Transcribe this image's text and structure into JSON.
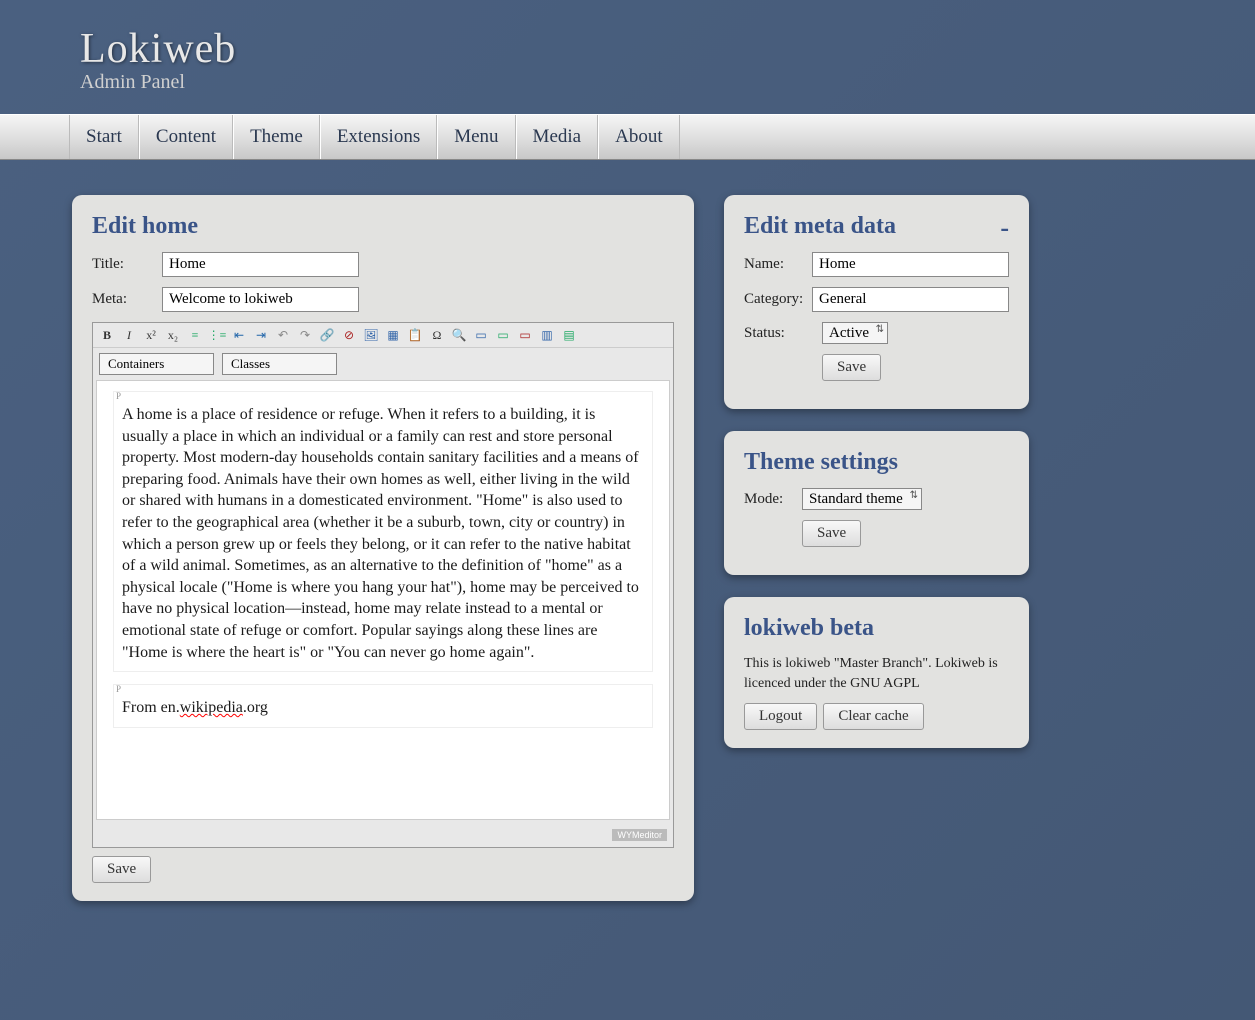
{
  "header": {
    "title": "Lokiweb",
    "subtitle": "Admin Panel"
  },
  "nav": {
    "items": [
      "Start",
      "Content",
      "Theme",
      "Extensions",
      "Menu",
      "Media",
      "About"
    ]
  },
  "editor": {
    "heading": "Edit home",
    "title_label": "Title:",
    "title_value": "Home",
    "meta_label": "Meta:",
    "meta_value": "Welcome to lokiweb",
    "tabs": {
      "containers": "Containers",
      "classes": "Classes"
    },
    "content_p1": "A home is a place of residence or refuge. When it refers to a building, it is usually a place in which an individual or a family can rest and store personal property. Most modern-day households contain sanitary facilities and a means of preparing food. Animals have their own homes as well, either living in the wild or shared with humans in a domesticated environment. \"Home\" is also used to refer to the geographical area (whether it be a suburb, town, city or country) in which a person grew up or feels they belong, or it can refer to the native habitat of a wild animal. Sometimes, as an alternative to the definition of \"home\" as a physical locale (\"Home is where you hang your hat\"), home may be perceived to have no physical location—instead, home may relate instead to a mental or emotional state of refuge or comfort. Popular sayings along these lines are \"Home is where the heart is\" or \"You can never go home again\".",
    "content_p2_prefix": "From en.",
    "content_p2_mid": "wikipedia",
    "content_p2_suffix": ".org",
    "wym_badge": "WYMeditor",
    "save": "Save"
  },
  "toolbar_icons": [
    "bold-icon",
    "italic-icon",
    "superscript-icon",
    "subscript-icon",
    "ordered-list-icon",
    "unordered-list-icon",
    "outdent-icon",
    "indent-icon",
    "undo-icon",
    "redo-icon",
    "link-icon",
    "unlink-icon",
    "image-icon",
    "table-icon",
    "paste-icon",
    "special-char-icon",
    "preview-icon",
    "align-left-icon",
    "align-center-icon",
    "align-right-icon",
    "row-icon",
    "column-icon"
  ],
  "meta_panel": {
    "heading": "Edit meta data",
    "collapse": "-",
    "name_label": "Name:",
    "name_value": "Home",
    "category_label": "Category:",
    "category_value": "General",
    "status_label": "Status:",
    "status_value": "Active",
    "save": "Save"
  },
  "theme_panel": {
    "heading": "Theme settings",
    "mode_label": "Mode:",
    "mode_value": "Standard theme",
    "save": "Save"
  },
  "beta_panel": {
    "heading": "lokiweb beta",
    "text": "This is lokiweb \"Master Branch\". Lokiweb is licenced under the GNU AGPL",
    "logout": "Logout",
    "clear": "Clear cache"
  }
}
